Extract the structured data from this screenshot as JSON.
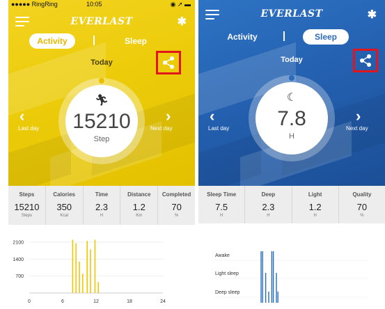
{
  "left": {
    "status": {
      "carrier": "●●●●● RingRing",
      "time": "10:05"
    },
    "brand": "EVERLAST",
    "tabs": [
      {
        "label": "Activity",
        "active": true
      },
      {
        "label": "Sleep",
        "active": false
      }
    ],
    "tab_separator": "|",
    "day": "Today",
    "icons": {
      "menu": "menu-icon",
      "bluetooth": "bluetooth-icon",
      "share": "share-icon",
      "metric": "running-person-icon",
      "prev": "chevron-left-icon",
      "next": "chevron-right-icon"
    },
    "metric": {
      "value": "15210",
      "unit": "Step"
    },
    "prev_label": "Last day",
    "next_label": "Next day",
    "stats": [
      {
        "label": "Steps",
        "value": "15210",
        "unit": "Steps"
      },
      {
        "label": "Calories",
        "value": "350",
        "unit": "Kcal"
      },
      {
        "label": "Time",
        "value": "2.3",
        "unit": "H"
      },
      {
        "label": "Distance",
        "value": "1.2",
        "unit": "Km"
      },
      {
        "label": "Completed",
        "value": "70",
        "unit": "%"
      }
    ],
    "colors": {
      "accent": "#e8c000",
      "share_highlight": "#e2141c"
    }
  },
  "right": {
    "brand": "EVERLAST",
    "tabs": [
      {
        "label": "Activity",
        "active": false
      },
      {
        "label": "Sleep",
        "active": true
      }
    ],
    "tab_separator": "|",
    "day": "Today",
    "icons": {
      "menu": "menu-icon",
      "bluetooth": "bluetooth-icon",
      "share": "share-icon",
      "metric": "sleeping-person-icon",
      "prev": "chevron-left-icon",
      "next": "chevron-right-icon"
    },
    "metric": {
      "value": "7.8",
      "unit": "H"
    },
    "prev_label": "Last day",
    "next_label": "Next day",
    "stats": [
      {
        "label": "Sleep Time",
        "value": "7.5",
        "unit": "H"
      },
      {
        "label": "Deep",
        "value": "2.3",
        "unit": "H"
      },
      {
        "label": "Light",
        "value": "1.2",
        "unit": "H"
      },
      {
        "label": "Quality",
        "value": "70",
        "unit": "%"
      }
    ],
    "colors": {
      "accent": "#2a6bbb",
      "share_highlight": "#e2141c"
    }
  },
  "chart_data": [
    {
      "type": "bar",
      "x_ticks": [
        0,
        6,
        12,
        18,
        24
      ],
      "y_ticks": [
        700,
        1400,
        2100
      ],
      "ylim": [
        0,
        2300
      ],
      "xlim": [
        0,
        24
      ],
      "color": "#f0c800",
      "bars": [
        {
          "x": 7.8,
          "value": 2200
        },
        {
          "x": 8.4,
          "value": 2050
        },
        {
          "x": 9.0,
          "value": 1300
        },
        {
          "x": 9.6,
          "value": 800
        },
        {
          "x": 10.4,
          "value": 2150
        },
        {
          "x": 11.0,
          "value": 1800
        },
        {
          "x": 11.8,
          "value": 2200
        },
        {
          "x": 12.4,
          "value": 450
        }
      ]
    },
    {
      "type": "bar",
      "y_categories": [
        "Deep sleep",
        "Light sleep",
        "Awake"
      ],
      "color": "#2a6bbb",
      "bars": [
        {
          "x": 0.3,
          "level": 3
        },
        {
          "x": 0.31,
          "level": 3
        },
        {
          "x": 0.33,
          "level": 2
        },
        {
          "x": 0.35,
          "level": 1
        },
        {
          "x": 0.37,
          "level": 3
        },
        {
          "x": 0.38,
          "level": 3
        },
        {
          "x": 0.4,
          "level": 2
        },
        {
          "x": 0.41,
          "level": 1
        }
      ]
    }
  ]
}
